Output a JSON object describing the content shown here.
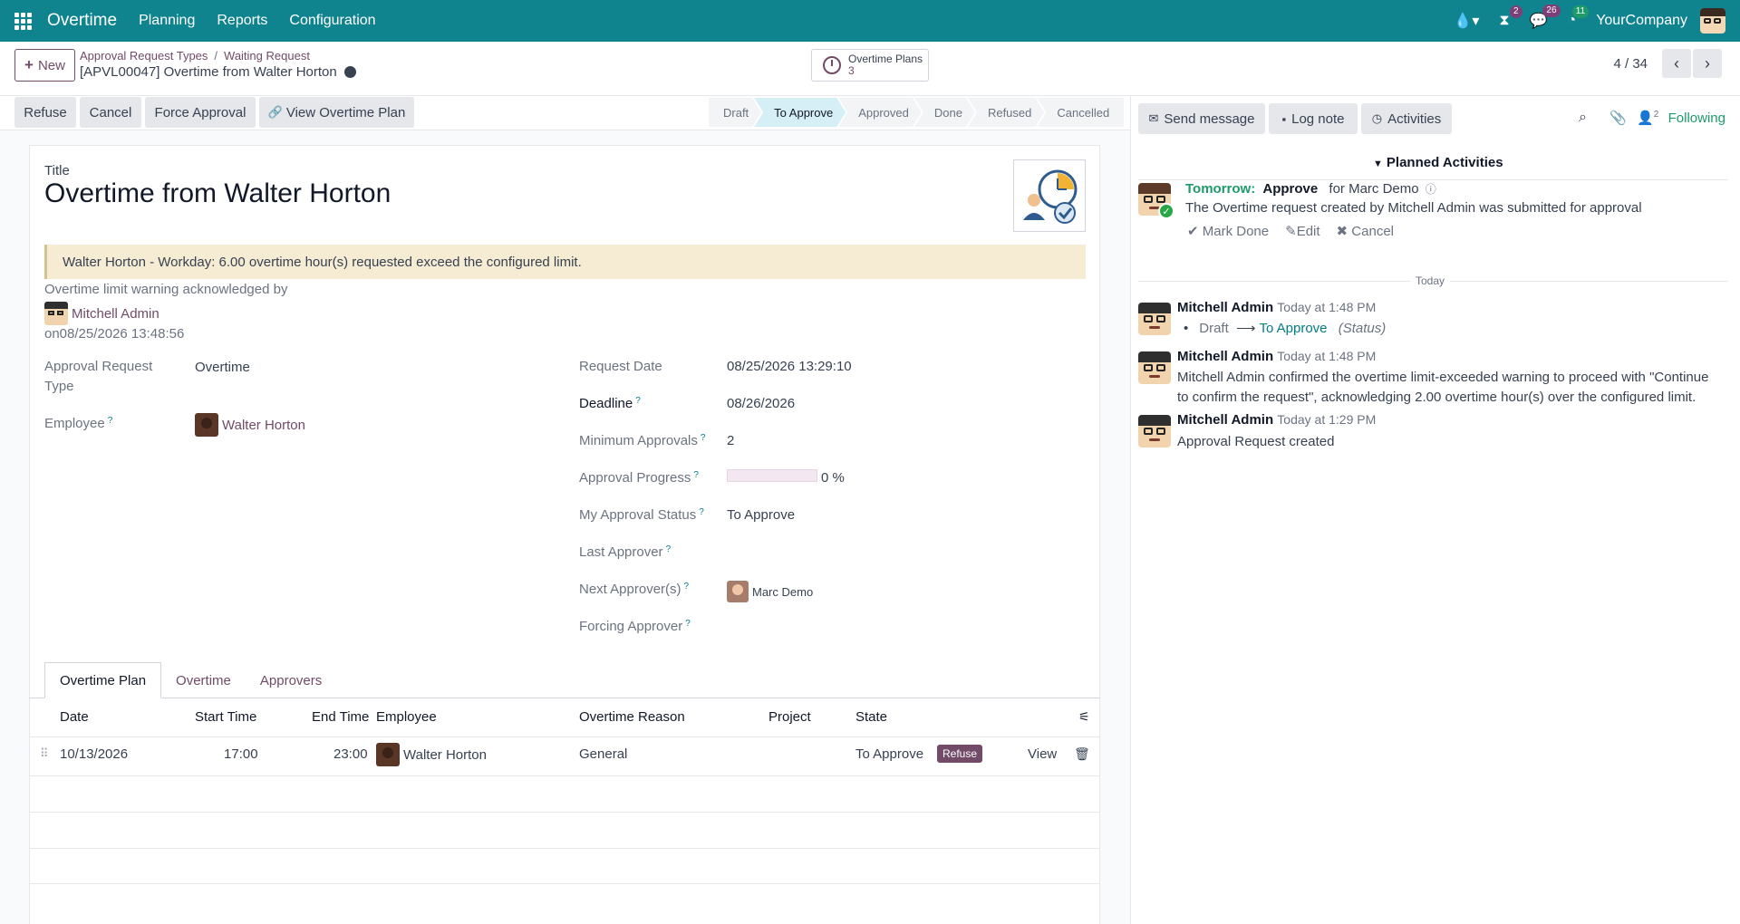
{
  "navbar": {
    "app_name": "Overtime",
    "menus": [
      "Planning",
      "Reports",
      "Configuration"
    ],
    "badges": {
      "timer": "2",
      "messages": "26",
      "activities": "11"
    },
    "company": "YourCompany"
  },
  "control_panel": {
    "new_label": "New",
    "breadcrumb": [
      "Approval Request Types",
      "Waiting Request"
    ],
    "record_name": "[APVL00047] Overtime from Walter Horton",
    "smart_button": {
      "label": "Overtime Plans",
      "count": "3"
    },
    "pager": "4 / 34"
  },
  "status_bar": {
    "buttons": [
      "Refuse",
      "Cancel",
      "Force Approval",
      "View Overtime Plan"
    ],
    "stages": [
      "Draft",
      "To Approve",
      "Approved",
      "Done",
      "Refused",
      "Cancelled"
    ],
    "active_stage": "To Approve"
  },
  "form": {
    "title_label": "Title",
    "title": "Overtime from Walter Horton",
    "warning": "Walter Horton - Workday: 6.00 overtime hour(s) requested exceed the configured limit.",
    "ack_label": "Overtime limit warning acknowledged by",
    "ack_user": "Mitchell Admin",
    "ack_date": "on08/25/2026 13:48:56",
    "left_fields": {
      "approval_type_label_1": "Approval Request",
      "approval_type_label_2": "Type",
      "approval_type": "Overtime",
      "employee_label": "Employee",
      "employee": "Walter Horton"
    },
    "right_fields": {
      "request_date_label": "Request Date",
      "request_date": "08/25/2026 13:29:10",
      "deadline_label": "Deadline",
      "deadline": "08/26/2026",
      "min_approvals_label": "Minimum Approvals",
      "min_approvals": "2",
      "progress_label": "Approval Progress",
      "progress_text": "0 %",
      "progress_value": 0,
      "my_status_label": "My Approval Status",
      "my_status": "To Approve",
      "last_approver_label": "Last Approver",
      "next_approver_label": "Next Approver(s)",
      "next_approver": "Marc Demo",
      "forcing_approver_label": "Forcing Approver"
    },
    "help_mark": "?"
  },
  "tabs": [
    "Overtime Plan",
    "Overtime",
    "Approvers"
  ],
  "table": {
    "headers": [
      "Date",
      "Start Time",
      "End Time",
      "Employee",
      "Overtime Reason",
      "Project",
      "State"
    ],
    "rows": [
      {
        "date": "10/13/2026",
        "start": "17:00",
        "end": "23:00",
        "employee": "Walter Horton",
        "reason": "General",
        "project": "",
        "state": "To Approve",
        "refuse": "Refuse",
        "view": "View"
      }
    ]
  },
  "chatter": {
    "send_message": "Send message",
    "log_note": "Log note",
    "activities": "Activities",
    "followers_count": "2",
    "following": "Following",
    "planned_title": "Planned Activities",
    "activity": {
      "when": "Tomorrow:",
      "type": "Approve",
      "for": "for Marc Demo",
      "text": "The Overtime request created by Mitchell Admin was submitted for approval",
      "mark_done": "Mark Done",
      "edit": "Edit",
      "cancel": "Cancel"
    },
    "today": "Today",
    "messages": [
      {
        "author": "Mitchell Admin",
        "date": "Today at 1:48 PM",
        "from": "Draft",
        "to": "To Approve",
        "field": "(Status)"
      },
      {
        "author": "Mitchell Admin",
        "date": "Today at 1:48 PM",
        "body_1": "Mitchell Admin confirmed the overtime limit-exceeded warning to proceed with \"Continue",
        "body_2": "to confirm the request\", acknowledging 2.00 overtime hour(s) over the configured limit."
      },
      {
        "author": "Mitchell Admin",
        "date": "Today at 1:29 PM",
        "body_1": "Approval Request created"
      }
    ]
  }
}
